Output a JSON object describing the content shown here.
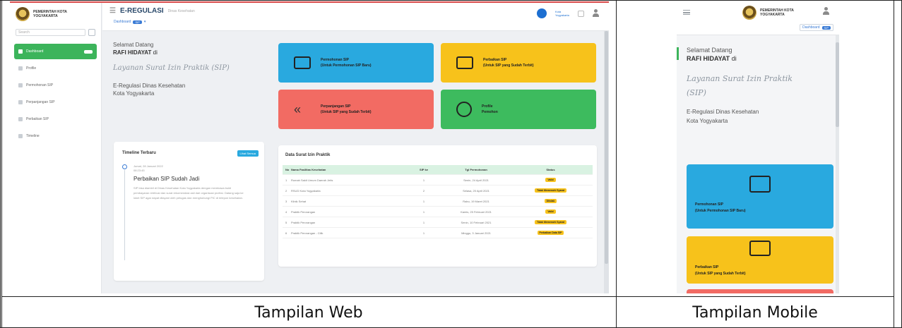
{
  "captions": {
    "web": "Tampilan Web",
    "mobile": "Tampilan Mobile"
  },
  "brand": {
    "org_line1": "PEMERINTAH KOTA",
    "org_line2": "YOGYAKARTA",
    "app_title": "E-REGULASI",
    "app_subtitle": "Dinas Kesehatan",
    "crumb": "Dashboard",
    "crumb_pill": "SIP",
    "globe_text": "Kota Yogyakarta"
  },
  "sidebar": {
    "search_placeholder": "Search",
    "items": [
      {
        "label": "Dashboard",
        "active": true
      },
      {
        "label": "Profile",
        "active": false
      },
      {
        "label": "Permohonan SIP",
        "active": false
      },
      {
        "label": "Perpanjangan SIP",
        "active": false
      },
      {
        "label": "Perbaikan SIP",
        "active": false
      },
      {
        "label": "Timeline",
        "active": false
      }
    ]
  },
  "welcome": {
    "greeting": "Selamat Datang",
    "name": "RAFI HIDAYAT",
    "name_suffix": "di",
    "service": "Layanan Surat Izin Praktik (SIP)",
    "service_mobile_1": "Layanan Surat Izin Praktik",
    "service_mobile_2": "(SIP)",
    "dept": "E-Regulasi Dinas Kesehatan",
    "city": "Kota Yogyakarta"
  },
  "tiles": [
    {
      "line1": "Permohonan SIP",
      "line2": "(Untuk Permohonan SIP Baru)",
      "color": "#29a9df",
      "icon": "id-card-icon"
    },
    {
      "line1": "Perbaikan SIP",
      "line2": "(Untuk SIP yang Sudah Terbit)",
      "color": "#f7c21b",
      "icon": "edit-icon"
    },
    {
      "line1": "Perpanjangan SIP",
      "line2": "(Untuk SIP yang Sudah Terbit)",
      "color": "#f26b63",
      "icon": "rewind-icon"
    },
    {
      "line1": "Profile",
      "line2": "Pemohon",
      "color": "#3dbb5e",
      "icon": "user-circle-icon"
    }
  ],
  "timeline": {
    "title": "Timeline Terbaru",
    "button": "Lihat Semua",
    "date": "Jumat, 28 Januari 2022",
    "time": "08:23:45",
    "entry_title": "Perbaikan SIP Sudah Jadi",
    "entry_desc": "SIP bisa diambil di Dinas Kesehatan Kota Yogyakarta dengan membawa bukti pembayaran retribusi dan surat rekomendasi asli dari organisasi profesi. Datang saja ke loket SIP agar dapat dilayani oleh petugas dan menghubungi PIC di telepon kesehatan."
  },
  "sip_table": {
    "title": "Data Surat Izin Praktik",
    "columns": [
      "No",
      "Nama Fasilitas Kesehatan",
      "SIP ke",
      "Tgl Permohonan",
      "Status"
    ],
    "rows": [
      {
        "no": "1",
        "name": "Rumah Sakit Umum Daerah Jetis",
        "ke": "1",
        "date": "Senin, 24 April 2021",
        "status": "Valid"
      },
      {
        "no": "2",
        "name": "RSUD Kota Yogyakarta",
        "ke": "2",
        "date": "Selasa, 20 April 2021",
        "status": "Tidak Memenuhi Syarat"
      },
      {
        "no": "3",
        "name": "Klinik Sehat",
        "ke": "1",
        "date": "Rabu, 19 Maret 2021",
        "status": "Ditolak"
      },
      {
        "no": "4",
        "name": "Praktik Perorangan",
        "ke": "1",
        "date": "Kamis, 25 Februari 2021",
        "status": "Valid"
      },
      {
        "no": "5",
        "name": "Praktik Perorangan",
        "ke": "1",
        "date": "Senin, 10 Februari 2021",
        "status": "Tidak Memenuhi Syarat"
      },
      {
        "no": "6",
        "name": "Praktik Perorangan - Cilik",
        "ke": "1",
        "date": "Minggu, 3 Januari 2021",
        "status": "Perbaikan Data SIP"
      }
    ]
  }
}
